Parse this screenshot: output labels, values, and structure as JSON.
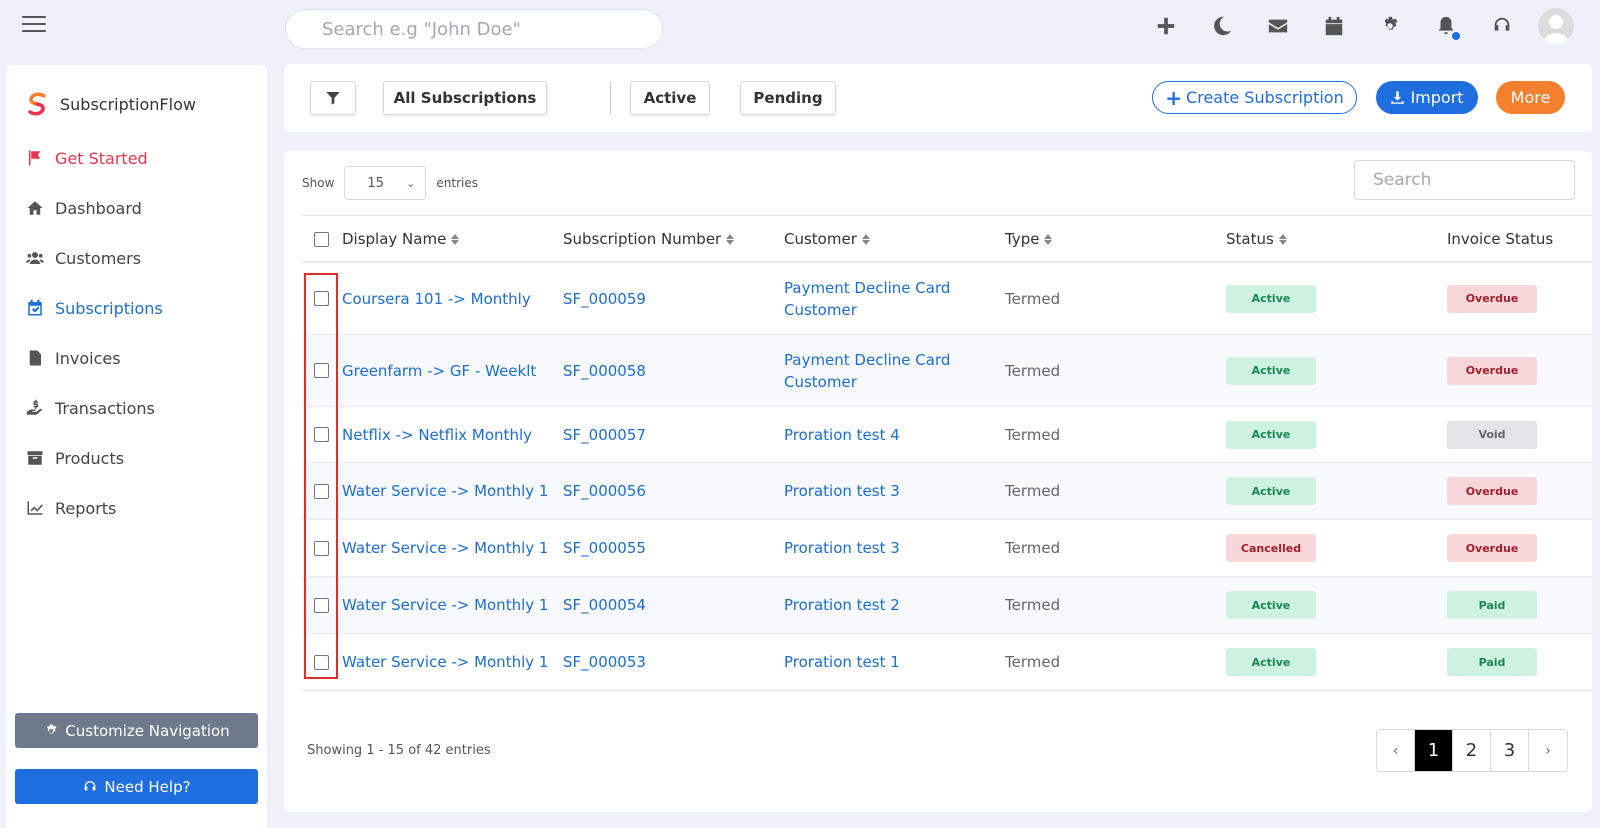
{
  "topbar": {
    "search_placeholder": "Search e.g \"John Doe\"",
    "icons": [
      "plus-icon",
      "moon-icon",
      "envelope-icon",
      "calendar-icon",
      "gear-icon",
      "bell-icon",
      "headset-icon"
    ]
  },
  "sidebar": {
    "brand": "SubscriptionFlow",
    "items": [
      {
        "label": "Get Started",
        "icon": "flag-icon"
      },
      {
        "label": "Dashboard",
        "icon": "home-icon"
      },
      {
        "label": "Customers",
        "icon": "users-icon"
      },
      {
        "label": "Subscriptions",
        "icon": "calendar-check-icon"
      },
      {
        "label": "Invoices",
        "icon": "invoice-icon"
      },
      {
        "label": "Transactions",
        "icon": "hand-dollar-icon"
      },
      {
        "label": "Products",
        "icon": "archive-icon"
      },
      {
        "label": "Reports",
        "icon": "chart-line-icon"
      }
    ],
    "customize_label": "Customize Navigation",
    "help_label": "Need Help?"
  },
  "filters": {
    "all_label": "All Subscriptions",
    "active_label": "Active",
    "pending_label": "Pending",
    "create_label": "Create Subscription",
    "import_label": "Import",
    "more_label": "More"
  },
  "table": {
    "show_label": "Show",
    "entries_label": "entries",
    "page_size": "15",
    "search_placeholder": "Search",
    "columns": [
      "Display Name",
      "Subscription Number",
      "Customer",
      "Type",
      "Status",
      "Invoice Status"
    ],
    "rows": [
      {
        "name": "Coursera 101 -> Monthly",
        "number": "SF_000059",
        "customer": "Payment Decline Card Customer",
        "type": "Termed",
        "status": "Active",
        "invoice": "Overdue"
      },
      {
        "name": "Greenfarm -> GF - Weeklt",
        "number": "SF_000058",
        "customer": "Payment Decline Card Customer",
        "type": "Termed",
        "status": "Active",
        "invoice": "Overdue"
      },
      {
        "name": "Netflix -> Netflix Monthly",
        "number": "SF_000057",
        "customer": "Proration test 4",
        "type": "Termed",
        "status": "Active",
        "invoice": "Void"
      },
      {
        "name": "Water Service -> Monthly 1",
        "number": "SF_000056",
        "customer": "Proration test 3",
        "type": "Termed",
        "status": "Active",
        "invoice": "Overdue"
      },
      {
        "name": "Water Service -> Monthly 1",
        "number": "SF_000055",
        "customer": "Proration test 3",
        "type": "Termed",
        "status": "Cancelled",
        "invoice": "Overdue"
      },
      {
        "name": "Water Service -> Monthly 1",
        "number": "SF_000054",
        "customer": "Proration test 2",
        "type": "Termed",
        "status": "Active",
        "invoice": "Paid"
      },
      {
        "name": "Water Service -> Monthly 1",
        "number": "SF_000053",
        "customer": "Proration test 1",
        "type": "Termed",
        "status": "Active",
        "invoice": "Paid"
      }
    ],
    "showing_text": "Showing 1 - 15 of 42 entries",
    "pages": [
      "‹",
      "1",
      "2",
      "3",
      "›"
    ],
    "current_page": "1"
  }
}
